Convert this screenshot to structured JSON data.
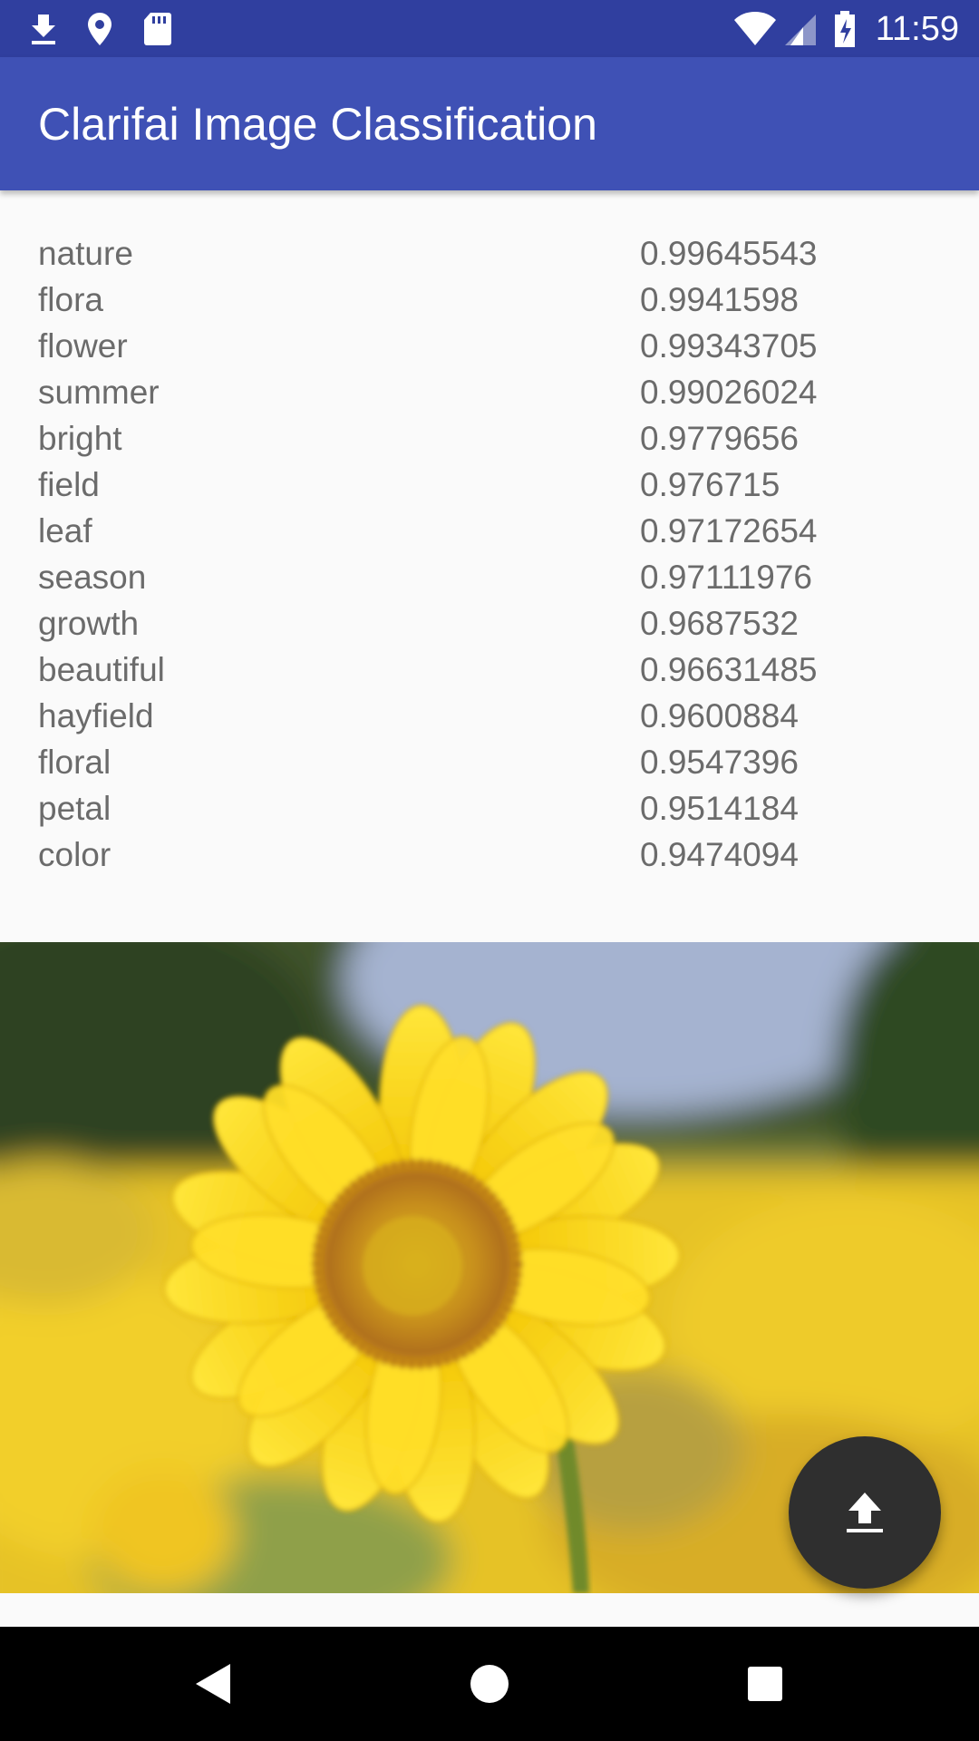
{
  "status_bar": {
    "time": "11:59",
    "left_icons": [
      "download-icon",
      "location-icon",
      "sd-card-icon"
    ],
    "right_icons": [
      "wifi-icon",
      "signal-icon",
      "battery-charging-icon"
    ],
    "color": "#303f9f"
  },
  "app_bar": {
    "title": "Clarifai Image Classification",
    "color": "#3f51b5"
  },
  "results": [
    {
      "concept": "nature",
      "score": "0.99645543"
    },
    {
      "concept": "flora",
      "score": "0.9941598"
    },
    {
      "concept": "flower",
      "score": "0.99343705"
    },
    {
      "concept": "summer",
      "score": "0.99026024"
    },
    {
      "concept": "bright",
      "score": "0.9779656"
    },
    {
      "concept": "field",
      "score": "0.976715"
    },
    {
      "concept": "leaf",
      "score": "0.97172654"
    },
    {
      "concept": "season",
      "score": "0.97111976"
    },
    {
      "concept": "growth",
      "score": "0.9687532"
    },
    {
      "concept": "beautiful",
      "score": "0.96631485"
    },
    {
      "concept": "hayfield",
      "score": "0.9600884"
    },
    {
      "concept": "floral",
      "score": "0.9547396"
    },
    {
      "concept": "petal",
      "score": "0.9514184"
    },
    {
      "concept": "color",
      "score": "0.9474094"
    }
  ],
  "photo": {
    "subject": "sunflower-field-photo"
  },
  "fab": {
    "icon": "upload-icon",
    "color": "#2f2f2f"
  },
  "nav_bar": {
    "buttons": [
      "back-icon",
      "home-icon",
      "recents-icon"
    ]
  }
}
